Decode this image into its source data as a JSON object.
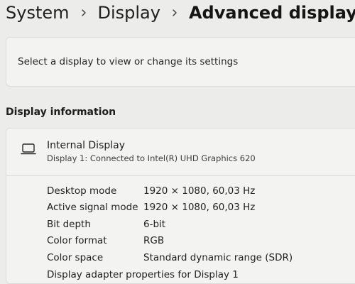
{
  "breadcrumb": {
    "items": [
      "System",
      "Display",
      "Advanced display"
    ]
  },
  "select_display": {
    "text": "Select a display to view or change its settings"
  },
  "section": {
    "title": "Display information"
  },
  "display": {
    "icon": "laptop-icon",
    "name": "Internal Display",
    "subtitle": "Display 1: Connected to Intel(R) UHD Graphics 620"
  },
  "properties": [
    {
      "label": "Desktop mode",
      "value": "1920 × 1080, 60,03 Hz"
    },
    {
      "label": "Active signal mode",
      "value": "1920 × 1080, 60,03 Hz"
    },
    {
      "label": "Bit depth",
      "value": "6-bit"
    },
    {
      "label": "Color format",
      "value": "RGB"
    },
    {
      "label": "Color space",
      "value": "Standard dynamic range (SDR)"
    }
  ],
  "adapter_link": {
    "label": "Display adapter properties for Display 1"
  },
  "colors": {
    "background": "#ececea",
    "card": "#f3f3f2",
    "text": "#1d1d1d"
  }
}
